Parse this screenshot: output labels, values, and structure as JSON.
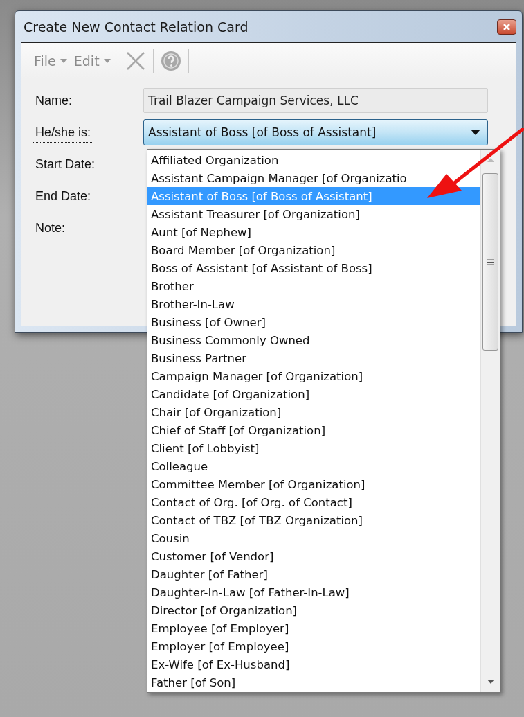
{
  "window": {
    "title": "Create New Contact Relation Card"
  },
  "toolbar": {
    "menus": [
      {
        "label": "File",
        "disabled": true
      },
      {
        "label": "Edit",
        "disabled": true
      }
    ],
    "tools": [
      {
        "kind": "delete",
        "disabled": true
      },
      {
        "kind": "help",
        "disabled": true
      }
    ]
  },
  "form": {
    "rows": [
      {
        "label": "Name:",
        "kind": "text",
        "value": "Trail Blazer Campaign Services, LLC",
        "focused": false
      },
      {
        "label": "He/she is:",
        "kind": "combo",
        "value": "Assistant of Boss [of Boss of Assistant]",
        "focused": true
      },
      {
        "label": "Start Date:",
        "kind": "hidden",
        "focused": false
      },
      {
        "label": "End Date:",
        "kind": "hidden",
        "focused": false
      },
      {
        "label": "Note:",
        "kind": "hidden",
        "focused": false
      }
    ]
  },
  "dropdown": {
    "items": [
      {
        "label": "Affiliated Organization",
        "selected": false
      },
      {
        "label": "Assistant Campaign Manager [of Organizatio",
        "selected": false
      },
      {
        "label": "Assistant of Boss [of Boss of Assistant]",
        "selected": true
      },
      {
        "label": "Assistant Treasurer [of Organization]",
        "selected": false
      },
      {
        "label": "Aunt [of Nephew]",
        "selected": false
      },
      {
        "label": "Board Member [of Organization]",
        "selected": false
      },
      {
        "label": "Boss of Assistant [of Assistant of Boss]",
        "selected": false
      },
      {
        "label": "Brother",
        "selected": false
      },
      {
        "label": "Brother-In-Law",
        "selected": false
      },
      {
        "label": "Business [of Owner]",
        "selected": false
      },
      {
        "label": "Business Commonly Owned",
        "selected": false
      },
      {
        "label": "Business Partner",
        "selected": false
      },
      {
        "label": "Campaign Manager [of Organization]",
        "selected": false
      },
      {
        "label": "Candidate [of Organization]",
        "selected": false
      },
      {
        "label": "Chair [of Organization]",
        "selected": false
      },
      {
        "label": "Chief of Staff [of Organization]",
        "selected": false
      },
      {
        "label": "Client [of Lobbyist]",
        "selected": false
      },
      {
        "label": "Colleague",
        "selected": false
      },
      {
        "label": "Committee Member [of Organization]",
        "selected": false
      },
      {
        "label": "Contact of Org. [of Org. of Contact]",
        "selected": false
      },
      {
        "label": "Contact of TBZ [of TBZ Organization]",
        "selected": false
      },
      {
        "label": "Cousin",
        "selected": false
      },
      {
        "label": "Customer [of Vendor]",
        "selected": false
      },
      {
        "label": "Daughter [of Father]",
        "selected": false
      },
      {
        "label": "Daughter-In-Law [of Father-In-Law]",
        "selected": false
      },
      {
        "label": "Director [of Organization]",
        "selected": false
      },
      {
        "label": "Employee [of Employer]",
        "selected": false
      },
      {
        "label": "Employer [of Employee]",
        "selected": false
      },
      {
        "label": "Ex-Wife [of Ex-Husband]",
        "selected": false
      },
      {
        "label": "Father [of Son]",
        "selected": false
      }
    ]
  }
}
